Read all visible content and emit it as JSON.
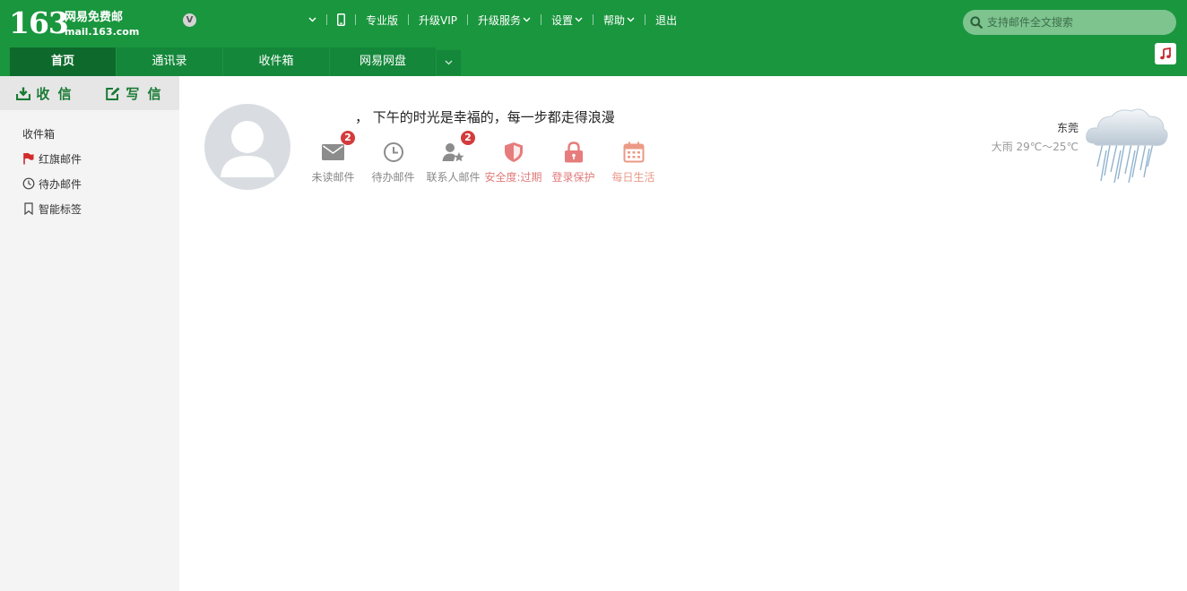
{
  "logo": {
    "number": "163",
    "name": "网易免费邮",
    "domain": "mail.163.com",
    "vip_mark": "V"
  },
  "topnav": {
    "pro": "专业版",
    "upgrade_vip": "升级VIP",
    "upgrade_service": "升级服务",
    "settings": "设置",
    "help": "帮助",
    "logout": "退出"
  },
  "search": {
    "placeholder": "支持邮件全文搜索"
  },
  "tabs": [
    "首页",
    "通讯录",
    "收件箱",
    "网易网盘"
  ],
  "sidebar": {
    "receive": "收 信",
    "compose": "写 信",
    "items": [
      {
        "label": "收件箱",
        "icon": ""
      },
      {
        "label": "红旗邮件",
        "icon": "red-flag-icon"
      },
      {
        "label": "待办邮件",
        "icon": "clock-icon"
      },
      {
        "label": "智能标签",
        "icon": "bookmark-icon"
      }
    ]
  },
  "greeting": "， 下午的时光是幸福的，每一步都走得浪漫",
  "shortcuts": [
    {
      "label": "未读邮件",
      "icon": "envelope-icon",
      "badge": "2"
    },
    {
      "label": "待办邮件",
      "icon": "clock-icon",
      "badge": ""
    },
    {
      "label": "联系人邮件",
      "icon": "contact-star-icon",
      "badge": "2"
    },
    {
      "label": "安全度:过期",
      "icon": "shield-icon",
      "badge": ""
    },
    {
      "label": "登录保护",
      "icon": "lock-icon",
      "badge": ""
    },
    {
      "label": "每日生活",
      "icon": "calendar-icon",
      "badge": ""
    }
  ],
  "weather": {
    "city": "东莞",
    "condition_temp": "大雨 29℃～25℃",
    "icon": "heavy-rain-cloud-icon"
  },
  "colors": {
    "brand_green": "#1a963e",
    "active_tab": "#0e6a2c",
    "badge_red": "#d23c3c",
    "warn_pink": "#e07a7a"
  }
}
